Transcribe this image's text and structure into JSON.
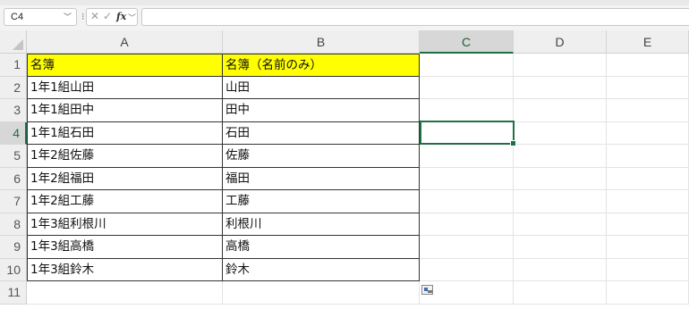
{
  "formula_bar": {
    "name_box": "C4",
    "separator": "⁝",
    "cancel_symbol": "✕",
    "enter_symbol": "✓",
    "fx_label": "fx",
    "formula": ""
  },
  "columns": [
    "A",
    "B",
    "C",
    "D",
    "E"
  ],
  "selected_column": "C",
  "selected_row": "4",
  "rows": [
    {
      "num": "1",
      "a": "名簿",
      "b": "名簿（名前のみ）"
    },
    {
      "num": "2",
      "a": "1年1組山田",
      "b": "山田"
    },
    {
      "num": "3",
      "a": "1年1組田中",
      "b": "田中"
    },
    {
      "num": "4",
      "a": "1年1組石田",
      "b": "石田"
    },
    {
      "num": "5",
      "a": "1年2組佐藤",
      "b": "佐藤"
    },
    {
      "num": "6",
      "a": "1年2組福田",
      "b": "福田"
    },
    {
      "num": "7",
      "a": "1年2組工藤",
      "b": "工藤"
    },
    {
      "num": "8",
      "a": "1年3組利根川",
      "b": "利根川"
    },
    {
      "num": "9",
      "a": "1年3組高橋",
      "b": "高橋"
    },
    {
      "num": "10",
      "a": "1年3組鈴木",
      "b": "鈴木"
    },
    {
      "num": "11",
      "a": "",
      "b": ""
    }
  ],
  "colors": {
    "header_fill": "#ffff00",
    "selection_green": "#1e7145"
  },
  "icons": {
    "paste_options": "paste-options-icon"
  }
}
